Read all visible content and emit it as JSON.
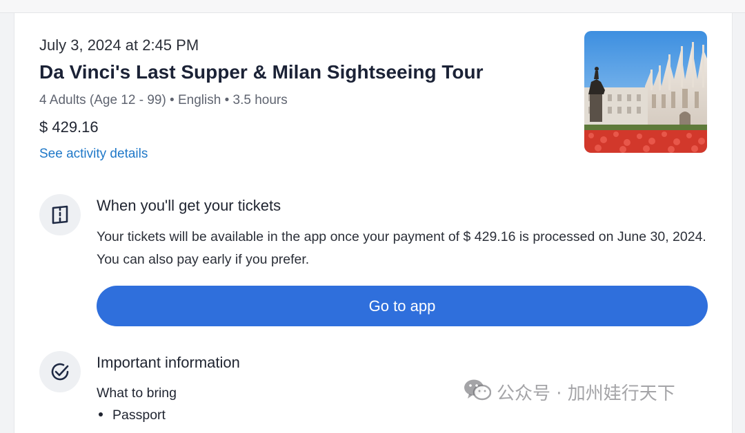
{
  "booking": {
    "date": "July 3, 2024 at 2:45 PM",
    "title": "Da Vinci's Last Supper & Milan Sightseeing Tour",
    "meta": "4 Adults (Age 12 - 99) • English • 3.5 hours",
    "price": "$ 429.16",
    "details_link": "See activity details",
    "photo": "milan-cathedral-photo"
  },
  "tickets": {
    "icon": "ticket-icon",
    "heading": "When you'll get your tickets",
    "body": "Your tickets will be available in the app once your payment of $ 429.16 is processed on June 30, 2024. You can also pay early if you prefer.",
    "button_label": "Go to app"
  },
  "important": {
    "icon": "check-circle-icon",
    "heading": "Important information",
    "bring_label": "What to bring",
    "bring_items": [
      "Passport"
    ]
  },
  "watermark": {
    "icon": "wechat-icon",
    "text": "公众号 · 加州娃行天下"
  },
  "colors": {
    "accent": "#2f6fdc",
    "link": "#1f78c8",
    "icon_bg": "#eef0f3"
  }
}
